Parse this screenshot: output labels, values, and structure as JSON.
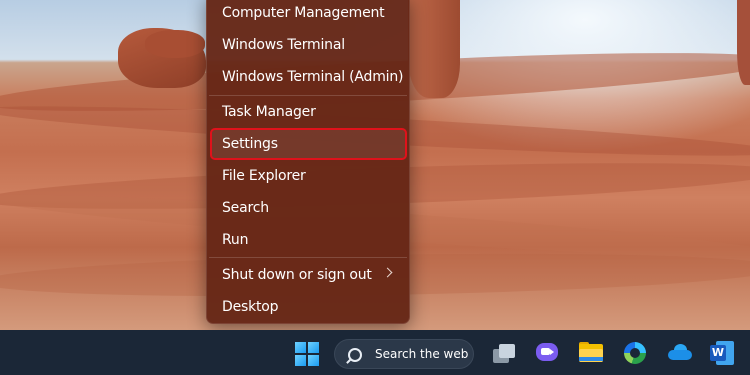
{
  "context_menu": {
    "items": [
      {
        "label": "Computer Management"
      },
      {
        "label": "Windows Terminal"
      },
      {
        "label": "Windows Terminal (Admin)"
      },
      {
        "label": "Task Manager"
      },
      {
        "label": "Settings",
        "highlighted": true
      },
      {
        "label": "File Explorer"
      },
      {
        "label": "Search"
      },
      {
        "label": "Run"
      },
      {
        "label": "Shut down or sign out",
        "has_submenu": true
      },
      {
        "label": "Desktop"
      }
    ],
    "highlight_color": "#e0121b"
  },
  "taskbar": {
    "search_label": "Search the web",
    "icons": [
      "windows-start-icon",
      "search-icon",
      "task-view-icon",
      "chat-icon",
      "file-explorer-icon",
      "edge-icon",
      "onedrive-icon",
      "word-icon"
    ],
    "word_letter": "W"
  }
}
